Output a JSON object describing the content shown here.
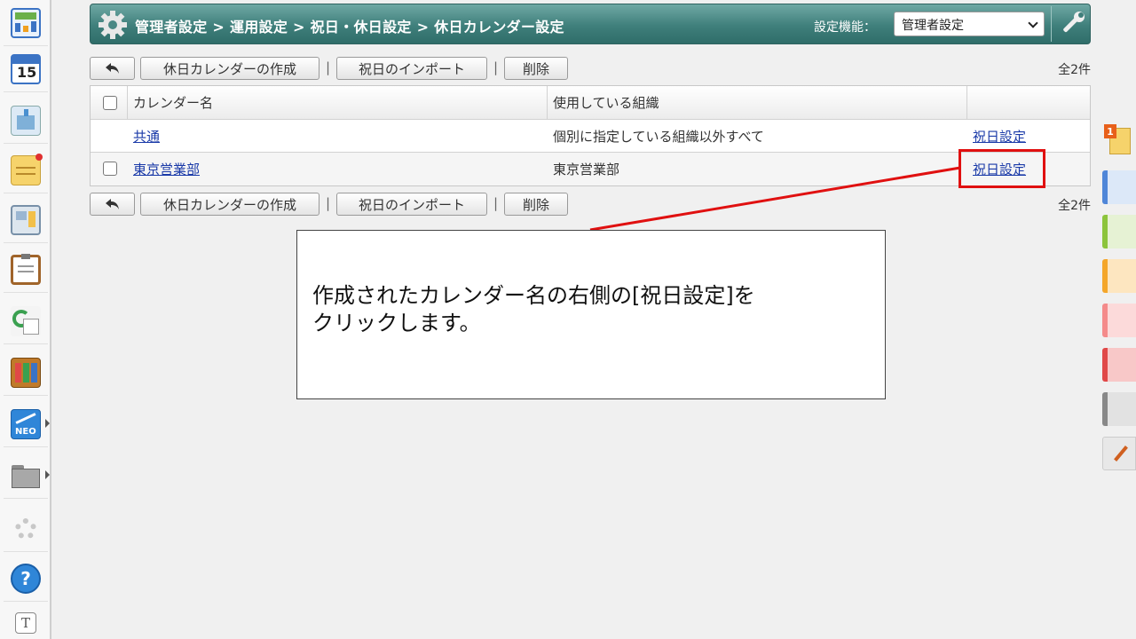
{
  "header": {
    "breadcrumb": "管理者設定 > 運用設定 > 祝日・休日設定 > 休日カレンダー設定",
    "setting_label": "設定機能：",
    "setting_select_value": "管理者設定",
    "colors": {
      "bar": "#3f7f7b"
    }
  },
  "sidebar": {
    "items": [
      {
        "icon": "portal-icon"
      },
      {
        "icon": "calendar-icon",
        "text": "15"
      },
      {
        "icon": "facility-icon"
      },
      {
        "icon": "memo-icon"
      },
      {
        "icon": "bulletin-board-icon"
      },
      {
        "icon": "clipboard-icon"
      },
      {
        "icon": "workflow-icon"
      },
      {
        "icon": "cabinet-icon"
      },
      {
        "icon": "neo-icon",
        "text": "NEO"
      },
      {
        "icon": "folder-icon"
      },
      {
        "icon": "settings-gear-icon"
      },
      {
        "icon": "help-icon",
        "text": "?"
      },
      {
        "icon": "text-icon",
        "text": "T"
      }
    ]
  },
  "right_dock": {
    "notification_count": "1",
    "tab_colors": [
      "#4f86d8",
      "#8cc43c",
      "#f4a62a",
      "#f48a8a",
      "#e04848",
      "#888888"
    ]
  },
  "toolbar": {
    "create_label": "休日カレンダーの作成",
    "import_label": "祝日のインポート",
    "delete_label": "削除",
    "separator": "|",
    "count": "全2件"
  },
  "table": {
    "headers": [
      "カレンダー名",
      "使用している組織"
    ],
    "rows": [
      {
        "name": "共通",
        "org": "個別に指定している組織以外すべて",
        "action": "祝日設定",
        "has_checkbox": false
      },
      {
        "name": "東京営業部",
        "org": "東京営業部",
        "action": "祝日設定",
        "has_checkbox": true
      }
    ]
  },
  "annotation": {
    "text_line1": "作成されたカレンダー名の右側の[祝日設定]を",
    "text_line2": "クリックします。",
    "color": "#e01010"
  }
}
